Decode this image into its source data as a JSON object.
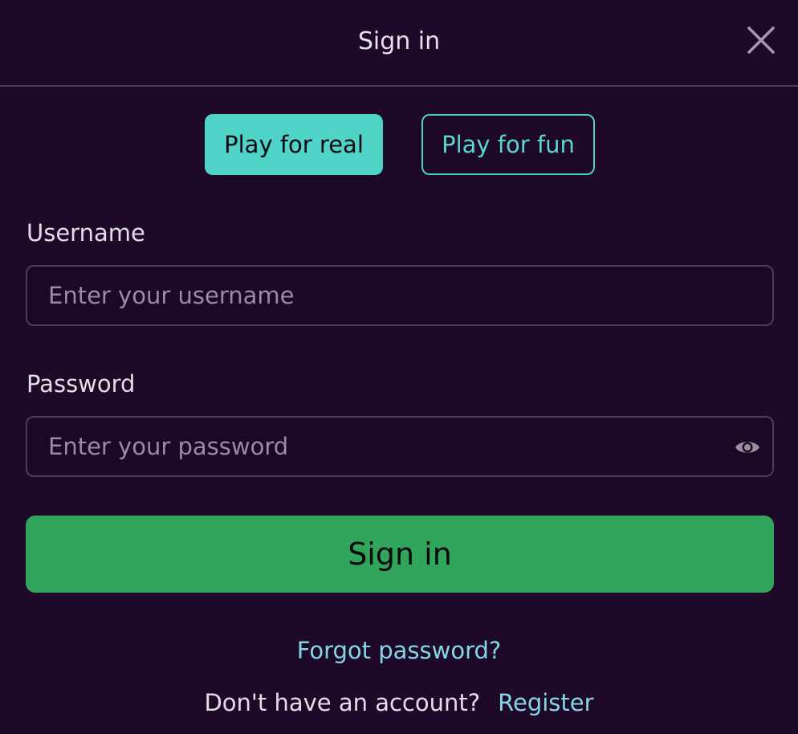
{
  "header": {
    "title": "Sign in",
    "close_icon": "close-icon"
  },
  "mode_toggle": {
    "real_label": "Play for real",
    "fun_label": "Play for fun",
    "selected": "Play for real"
  },
  "username": {
    "label": "Username",
    "placeholder": "Enter your username",
    "value": ""
  },
  "password": {
    "label": "Password",
    "placeholder": "Enter your password",
    "value": "",
    "toggle_icon": "eye-icon"
  },
  "submit": {
    "label": "Sign in"
  },
  "footer": {
    "forgot_label": "Forgot password?",
    "no_account_text": "Don't have an account?",
    "register_label": "Register"
  },
  "colors": {
    "background": "#1e0a28",
    "accent_teal": "#4fd3c7",
    "primary_green": "#32a55c",
    "link": "#84d6e6"
  }
}
